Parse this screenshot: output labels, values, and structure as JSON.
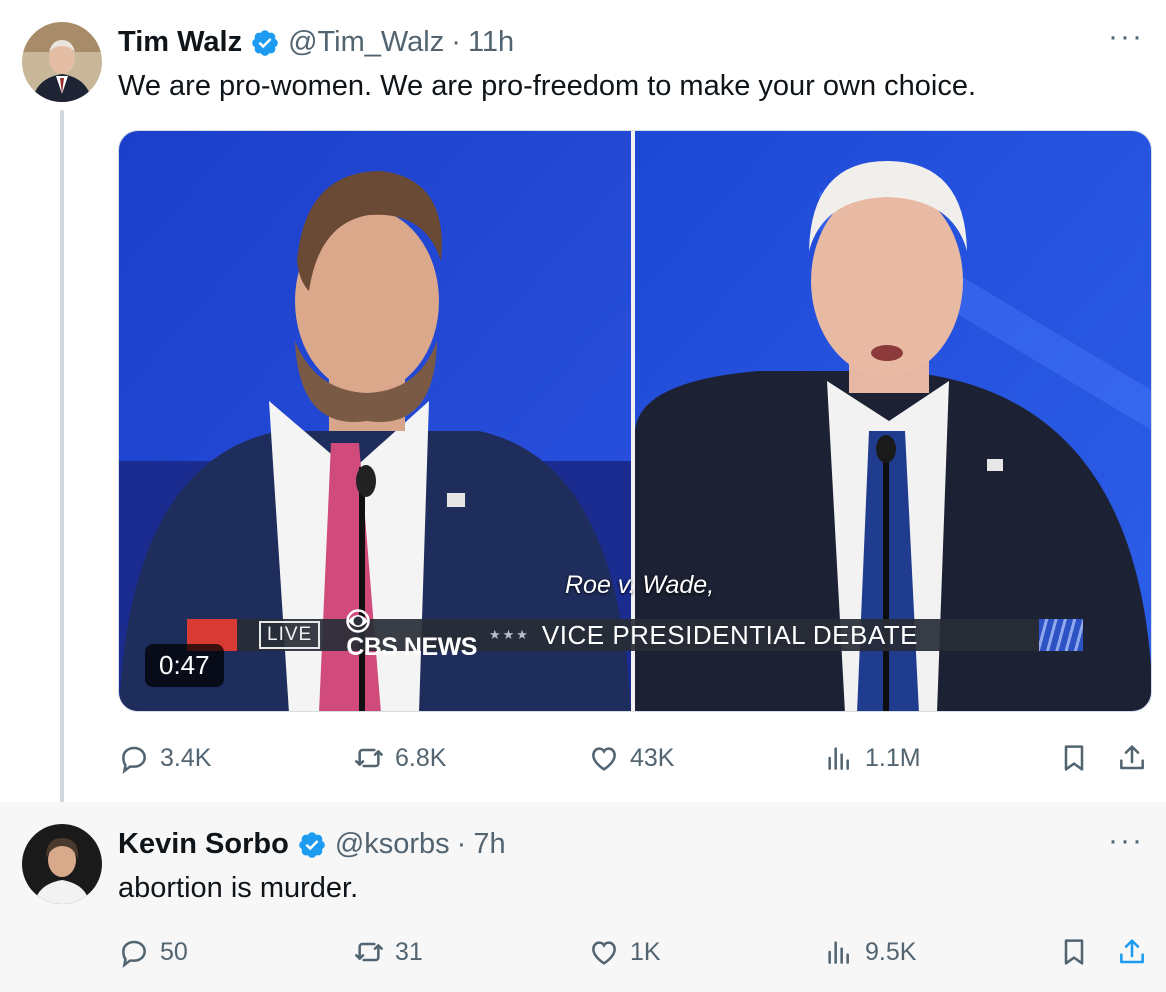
{
  "tweets": [
    {
      "name": "Tim Walz",
      "handle": "@Tim_Walz",
      "separator": "·",
      "time": "11h",
      "more": "···",
      "text": "We are pro-women. We are pro-freedom to make your own choice.",
      "media": {
        "duration": "0:47",
        "caption": "Roe v. Wade,",
        "live_badge": "LIVE",
        "network": "CBS NEWS",
        "stars": "★★★",
        "banner": "VICE PRESIDENTIAL DEBATE"
      },
      "stats": {
        "replies": "3.4K",
        "reposts": "6.8K",
        "likes": "43K",
        "views": "1.1M"
      }
    },
    {
      "name": "Kevin Sorbo",
      "handle": "@ksorbs",
      "separator": "·",
      "time": "7h",
      "more": "···",
      "text": "abortion is murder.",
      "stats": {
        "replies": "50",
        "reposts": "31",
        "likes": "1K",
        "views": "9.5K"
      }
    }
  ],
  "colors": {
    "verified": "#1d9bf0",
    "muted": "#536471",
    "accent": "#1d9bf0"
  },
  "icons": [
    "verified-badge-icon",
    "reply-icon",
    "repost-icon",
    "like-icon",
    "views-icon",
    "bookmark-icon",
    "share-icon",
    "more-icon"
  ]
}
